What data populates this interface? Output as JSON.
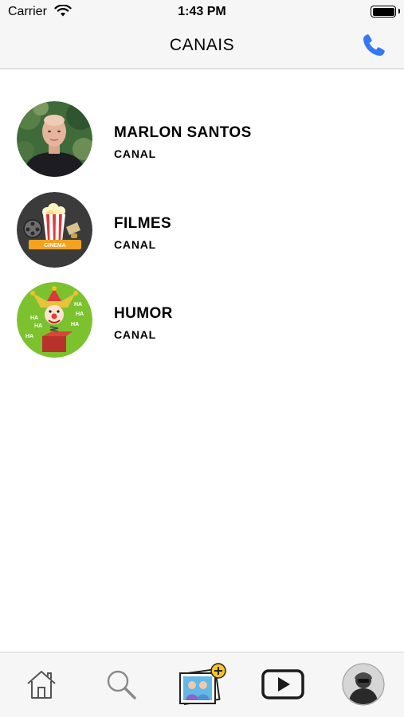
{
  "status_bar": {
    "carrier": "Carrier",
    "time": "1:43 PM",
    "wifi_icon": "wifi-icon",
    "battery_icon": "battery-icon"
  },
  "nav": {
    "title": "CANAIS",
    "call_icon": "phone-icon",
    "accent_color": "#3478f6"
  },
  "channels": [
    {
      "name": "MARLON SANTOS",
      "subtitle": "CANAL",
      "avatar": "person-photo"
    },
    {
      "name": "FILMES",
      "subtitle": "CANAL",
      "avatar": "cinema-popcorn-icon"
    },
    {
      "name": "HUMOR",
      "subtitle": "CANAL",
      "avatar": "jester-jack-in-the-box-icon",
      "avatar_text": "HA"
    }
  ],
  "tab_bar": {
    "tabs": [
      {
        "icon": "home-icon"
      },
      {
        "icon": "search-icon"
      },
      {
        "icon": "add-photo-icon"
      },
      {
        "icon": "play-icon"
      },
      {
        "icon": "profile-avatar-icon"
      }
    ]
  }
}
